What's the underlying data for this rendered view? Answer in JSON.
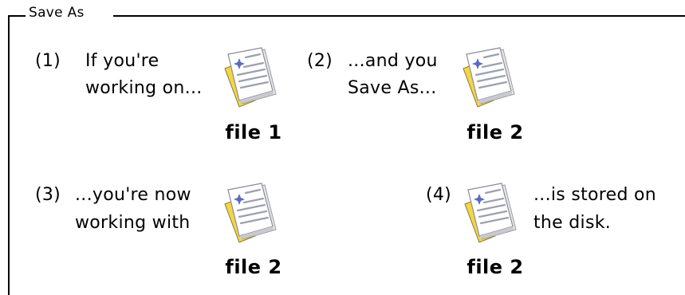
{
  "group": {
    "legend": "Save As"
  },
  "steps": [
    {
      "number": "(1)",
      "text_lines": [
        "If you're",
        "working on..."
      ],
      "file_label": "file 1",
      "icon": "document-icon"
    },
    {
      "number": "(2)",
      "text_lines": [
        "...and you",
        "Save As..."
      ],
      "file_label": "file 2",
      "icon": "document-icon"
    },
    {
      "number": "(3)",
      "text_lines": [
        "...you're now",
        "working with"
      ],
      "file_label": "file 2",
      "icon": "document-icon"
    },
    {
      "number": "(4)",
      "text_lines": [
        "...is stored on",
        "the disk."
      ],
      "file_label": "file 2",
      "icon": "document-icon"
    }
  ]
}
